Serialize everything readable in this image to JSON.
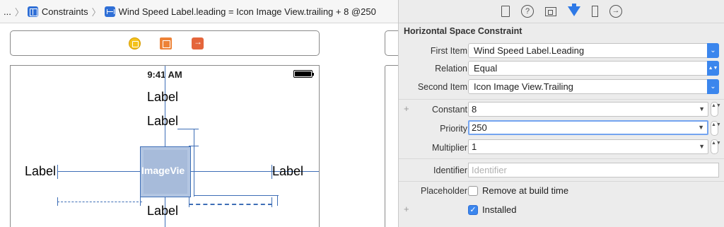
{
  "jumpbar": {
    "ellipsis": "...",
    "crumb1": "Constraints",
    "crumb2": "Wind Speed Label.leading = Icon Image View.trailing + 8 @250"
  },
  "canvas": {
    "status_time": "9:41 AM",
    "labels": [
      "Label",
      "Label",
      "Label",
      "Label",
      "Label"
    ],
    "image_view_text": "ImageVie"
  },
  "inspector": {
    "section_title": "Horizontal Space Constraint",
    "first_item": {
      "label": "First Item",
      "value": "Wind Speed Label.Leading"
    },
    "relation": {
      "label": "Relation",
      "value": "Equal"
    },
    "second_item": {
      "label": "Second Item",
      "value": "Icon Image View.Trailing"
    },
    "constant": {
      "label": "Constant",
      "value": "8"
    },
    "priority": {
      "label": "Priority",
      "value": "250"
    },
    "multiplier": {
      "label": "Multiplier",
      "value": "1"
    },
    "identifier": {
      "label": "Identifier",
      "placeholder": "Identifier"
    },
    "placeholder": {
      "label": "Placeholder",
      "checkbox_label": "Remove at build time",
      "checked": false
    },
    "installed": {
      "checkbox_label": "Installed",
      "checked": true
    },
    "plus": "+",
    "help_glyph": "?",
    "connections_glyph": "→",
    "check_glyph": "✓",
    "popup_arrow_glyph": "⌄",
    "combo_arrow_glyph": "▼",
    "stepper_glyph": "▲▼"
  }
}
